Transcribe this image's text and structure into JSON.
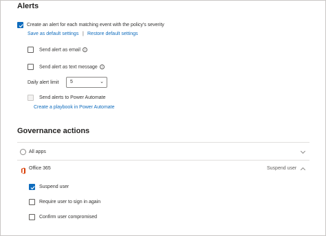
{
  "alerts": {
    "heading": "Alerts",
    "create_alert_label": "Create an alert for each matching event with the policy's severity",
    "create_alert_checked": true,
    "save_default_link": "Save as default settings",
    "separator": "|",
    "restore_default_link": "Restore default settings",
    "send_email_label": "Send alert as email",
    "send_text_label": "Send alert as text message",
    "daily_limit_label": "Daily alert limit",
    "daily_limit_value": "5",
    "power_automate_label": "Send alerts to Power Automate",
    "playbook_link": "Create a playbook in Power Automate"
  },
  "governance": {
    "heading": "Governance actions",
    "all_apps_label": "All apps",
    "office_label": "Office 365",
    "office_action": "Suspend user",
    "suspend_user_label": "Suspend user",
    "suspend_user_checked": true,
    "require_signin_label": "Require user to sign in again",
    "confirm_compromised_label": "Confirm user compromised"
  },
  "colors": {
    "accent": "#0f6cbd",
    "office_red": "#d83b01"
  },
  "icons": {
    "info": "info-icon",
    "office": "office-365-icon",
    "checkmark": "checkmark-icon"
  }
}
